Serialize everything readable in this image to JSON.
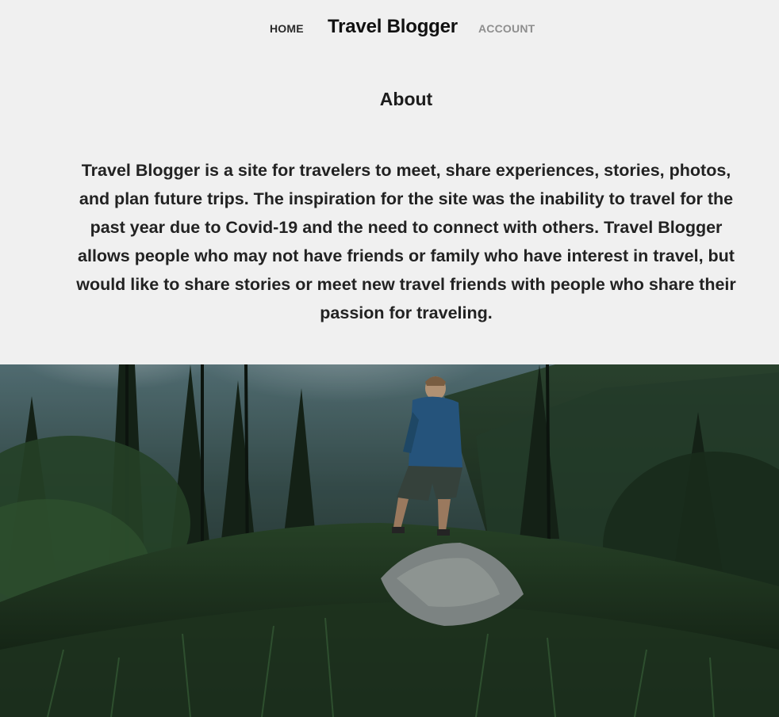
{
  "nav": {
    "home_label": "HOME",
    "brand": "Travel Blogger",
    "account_label": "ACCOUNT"
  },
  "about": {
    "title": "About",
    "body": "Travel Blogger is a site for travelers to meet, share experiences, stories, photos, and plan future trips. The inspiration for the site was the inability to travel for the past year due to Covid-19 and the need to connect with others. Travel Blogger allows people who may not have friends or family who have interest in travel, but would like to share stories or meet new travel friends with people who share their passion for traveling."
  },
  "hero": {
    "image": "hiker-on-forest-ridge-photo"
  }
}
